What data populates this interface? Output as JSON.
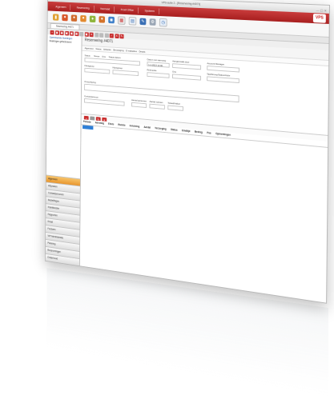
{
  "window": {
    "title": "VPS-suite 2 - [Reservering #4071]"
  },
  "menu": {
    "items": [
      "Algemeen",
      "Reservering",
      "Voorraad",
      "Front Office",
      "Systeem"
    ],
    "logo": "VPS"
  },
  "big_toolbar_icons": [
    "folder-icon",
    "users-icon",
    "users-icon",
    "users-icon",
    "key-icon",
    "users-icon",
    "globe-icon",
    "calendar-icon",
    "chart-icon",
    "pen-icon",
    "tools-icon",
    "clock-icon"
  ],
  "doc_tab": "Reservering #4071",
  "tree": {
    "items": [
      "Openstaande Boekingen",
      "Boekingen gefactureerd"
    ]
  },
  "nav": {
    "items": [
      "Algemeen",
      "Afspraken",
      "Contactpersonen",
      "Bestellingen",
      "Klantdossier",
      "Rapporten",
      "Email",
      "Facturen",
      "VIP Administratie",
      "Planning",
      "Reserveringen",
      "Onderhoud"
    ]
  },
  "main": {
    "title": "Reservering #4071",
    "subtabs": [
      "Algemeen",
      "Status",
      "Artikelen",
      "Bevestiging",
      "E-mailadres",
      "Details"
    ],
    "form": {
      "status": "Status",
      "nieuw": "Nieuw",
      "ons": "Ons",
      "status_datum": "Status datum",
      "datum_aanvang": "Datum van aanvang",
      "datum_value": "1-1-2013 12:00",
      "aangemaakt": "Aangemaakt door",
      "account": "Account Manager",
      "klantgroep": "Klantgroep",
      "klantgroep2": "Klantgroep",
      "referentie": "Referentie",
      "ons2": "Ons",
      "taal": "Taal/Groep/Status/Actie",
      "omschrijving": "Omschrijving",
      "contactpersoon": "Contactpersoon",
      "aantal_personen": "Aantal personen",
      "aantal_ruimte": "Aantal ruimten",
      "totaal": "Totaal/Artikel"
    },
    "grid_headers": [
      "Periode",
      "Aanvang",
      "Einde",
      "Ruimte",
      "Inrichting",
      "Aantal",
      "Verzorging",
      "Status",
      "Eindtijd",
      "Bedrag",
      "Pos",
      "Opmerkingen"
    ]
  }
}
